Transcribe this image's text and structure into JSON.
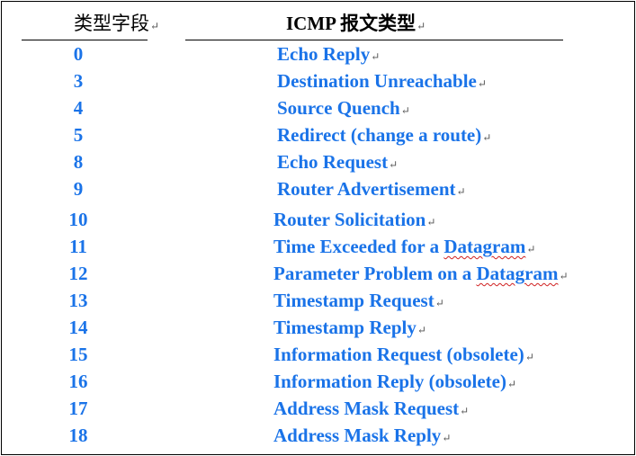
{
  "header": {
    "type_field": "类型字段",
    "message_type": "ICMP 报文类型"
  },
  "colors": {
    "text_blue": "#1a73e8",
    "header_black": "#000000",
    "spell_underline": "#d02020"
  },
  "rows": [
    {
      "code": "0",
      "desc": "Echo Reply"
    },
    {
      "code": "3",
      "desc": "Destination Unreachable"
    },
    {
      "code": "4",
      "desc": "Source Quench"
    },
    {
      "code": "5",
      "desc": "Redirect (change a route)"
    },
    {
      "code": "8",
      "desc": "Echo Request"
    },
    {
      "code": "9",
      "desc": "Router Advertisement"
    },
    {
      "code": "10",
      "desc": "Router Solicitation"
    },
    {
      "code": "11",
      "desc": "Time Exceeded for a Datagram"
    },
    {
      "code": "12",
      "desc": "Parameter Problem on a Datagram"
    },
    {
      "code": "13",
      "desc": "Timestamp Request"
    },
    {
      "code": "14",
      "desc": "Timestamp Reply"
    },
    {
      "code": "15",
      "desc": "Information Request (obsolete)"
    },
    {
      "code": "16",
      "desc": "Information Reply (obsolete)"
    },
    {
      "code": "17",
      "desc": "Address Mask Request"
    },
    {
      "code": "18",
      "desc": "Address Mask Reply"
    }
  ]
}
